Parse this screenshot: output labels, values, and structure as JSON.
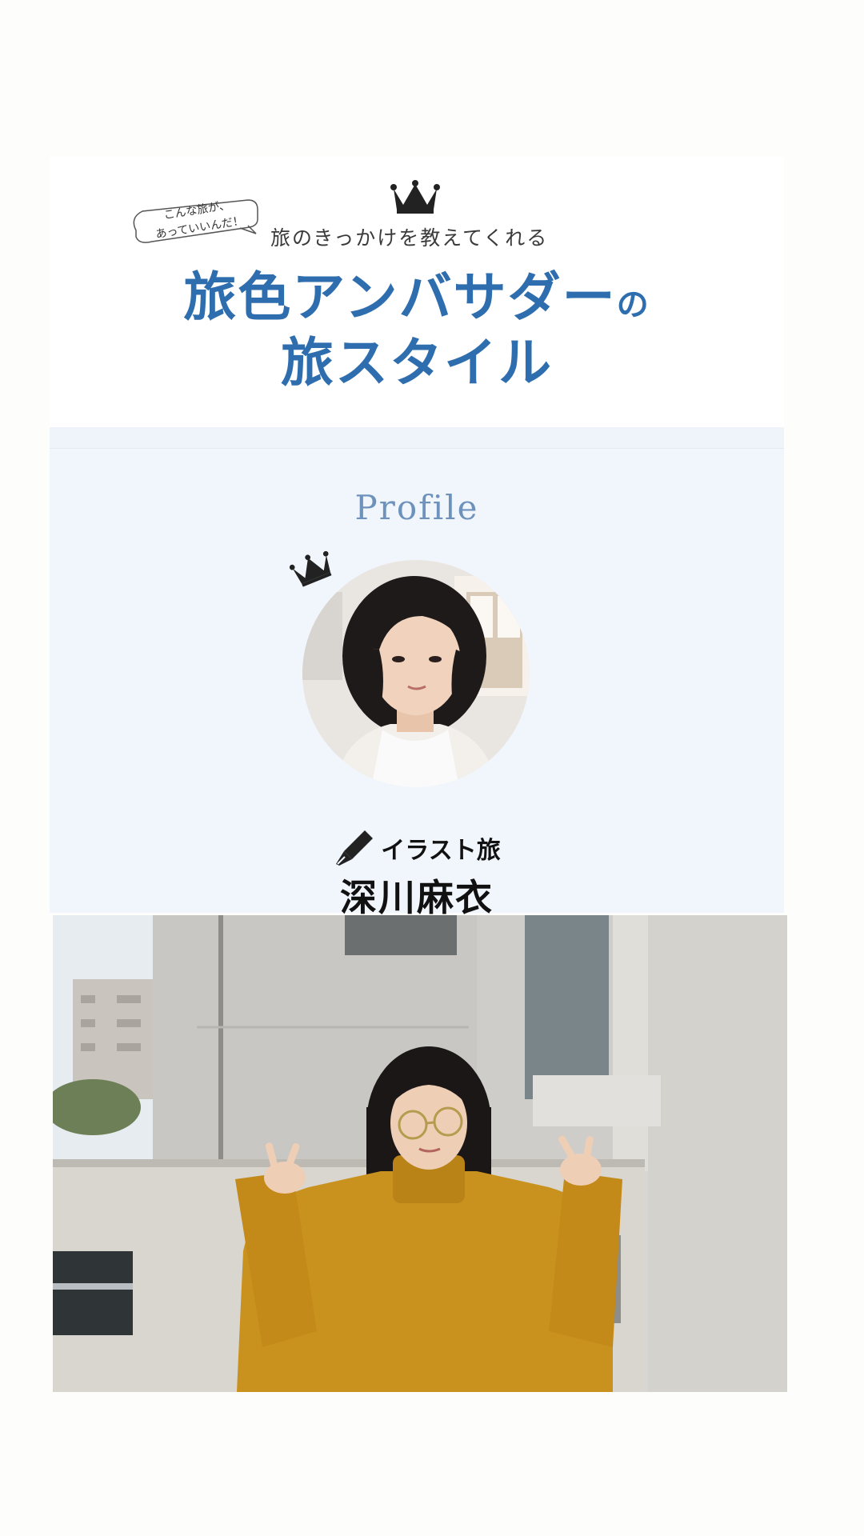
{
  "header": {
    "bubble_line1": "こんな旅が、",
    "bubble_line2": "あっていいんだ！",
    "subtitle": "旅のきっかけを教えてくれる",
    "title_line1": "旅色アンバサダー",
    "title_particle": "の",
    "title_line2": "旅スタイル"
  },
  "profile": {
    "heading": "Profile",
    "category": "イラスト旅",
    "name": "深川麻衣"
  },
  "colors": {
    "title_blue": "#2f6eae",
    "profile_heading": "#6d92bb",
    "profile_bg": "#f1f6fc",
    "sweater": "#c9921f"
  },
  "icons": [
    "crown-icon",
    "pen-icon"
  ]
}
